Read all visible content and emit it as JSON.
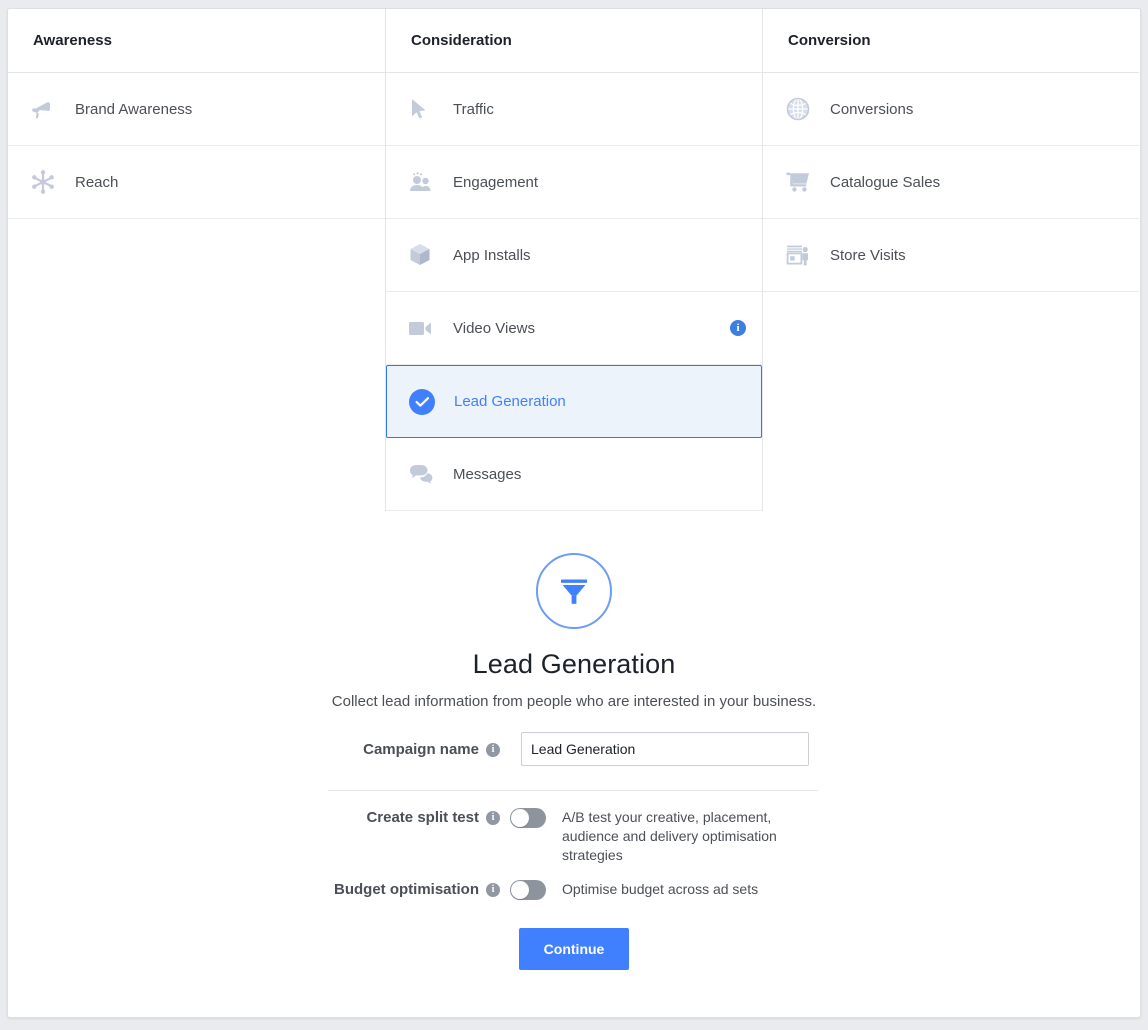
{
  "columns": [
    {
      "header": "Awareness",
      "items": [
        {
          "label": "Brand Awareness",
          "icon": "megaphone-icon",
          "selected": false,
          "info": false
        },
        {
          "label": "Reach",
          "icon": "reach-icon",
          "selected": false,
          "info": false
        }
      ]
    },
    {
      "header": "Consideration",
      "items": [
        {
          "label": "Traffic",
          "icon": "cursor-icon",
          "selected": false,
          "info": false
        },
        {
          "label": "Engagement",
          "icon": "people-icon",
          "selected": false,
          "info": false
        },
        {
          "label": "App Installs",
          "icon": "cube-icon",
          "selected": false,
          "info": false
        },
        {
          "label": "Video Views",
          "icon": "video-camera-icon",
          "selected": false,
          "info": true
        },
        {
          "label": "Lead Generation",
          "icon": "check-circle-icon",
          "selected": true,
          "info": false
        },
        {
          "label": "Messages",
          "icon": "messages-icon",
          "selected": false,
          "info": false
        }
      ]
    },
    {
      "header": "Conversion",
      "items": [
        {
          "label": "Conversions",
          "icon": "globe-icon",
          "selected": false,
          "info": false
        },
        {
          "label": "Catalogue Sales",
          "icon": "shopping-cart-icon",
          "selected": false,
          "info": false
        },
        {
          "label": "Store Visits",
          "icon": "storefront-icon",
          "selected": false,
          "info": false
        }
      ]
    }
  ],
  "detail": {
    "icon": "funnel-icon",
    "title": "Lead Generation",
    "description": "Collect lead information from people who are interested in your business."
  },
  "form": {
    "campaign_name": {
      "label": "Campaign name",
      "info_icon": "info-icon",
      "value": "Lead Generation",
      "placeholder": "Campaign name"
    },
    "split_test": {
      "label": "Create split test",
      "info_icon": "info-icon",
      "description": "A/B test your creative, placement, audience and delivery optimisation strategies",
      "enabled": false
    },
    "budget_optimisation": {
      "label": "Budget optimisation",
      "info_icon": "info-icon",
      "description": "Optimise budget across ad sets",
      "enabled": false
    },
    "continue_label": "Continue"
  },
  "colors": {
    "accent": "#4080ff",
    "selected_bg": "#edf3fb",
    "selected_border": "#3578e5",
    "icon_gray": "#c3cbdb",
    "text": "#4b4f56",
    "page_bg": "#e9ebee"
  }
}
